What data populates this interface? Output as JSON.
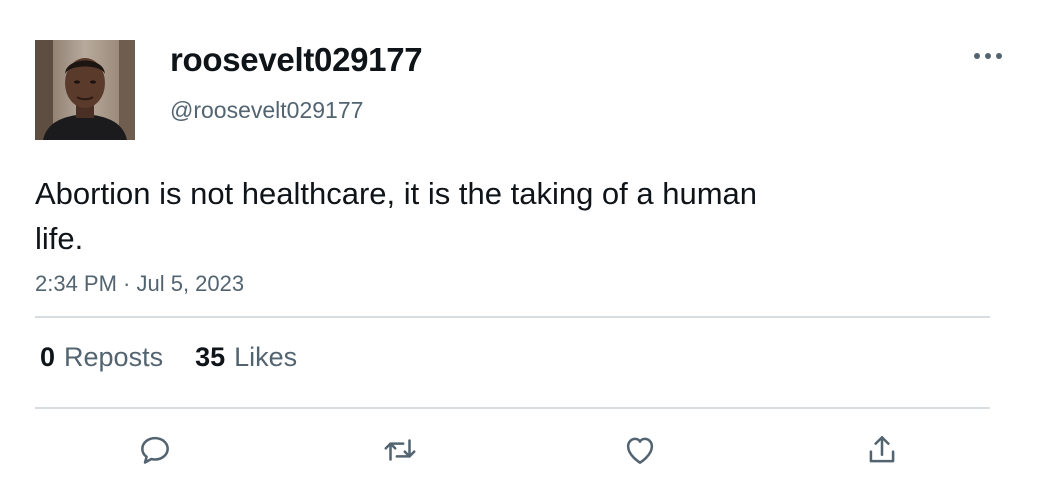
{
  "tweet": {
    "display_name": "roosevelt029177",
    "handle": "@roosevelt029177",
    "text": "Abortion is not healthcare, it is the taking of a human life.",
    "timestamp": "2:34 PM · Jul 5, 2023",
    "stats": {
      "reposts_count": "0",
      "reposts_label": "Reposts",
      "likes_count": "35",
      "likes_label": "Likes"
    }
  },
  "icons": {
    "more": "more-horizontal-icon",
    "reply": "reply-icon",
    "repost": "repost-icon",
    "like": "heart-icon",
    "share": "share-icon"
  },
  "colors": {
    "text_primary": "#0f1419",
    "text_secondary": "#536471",
    "divider": "#d8dde1",
    "icon": "#536471"
  }
}
